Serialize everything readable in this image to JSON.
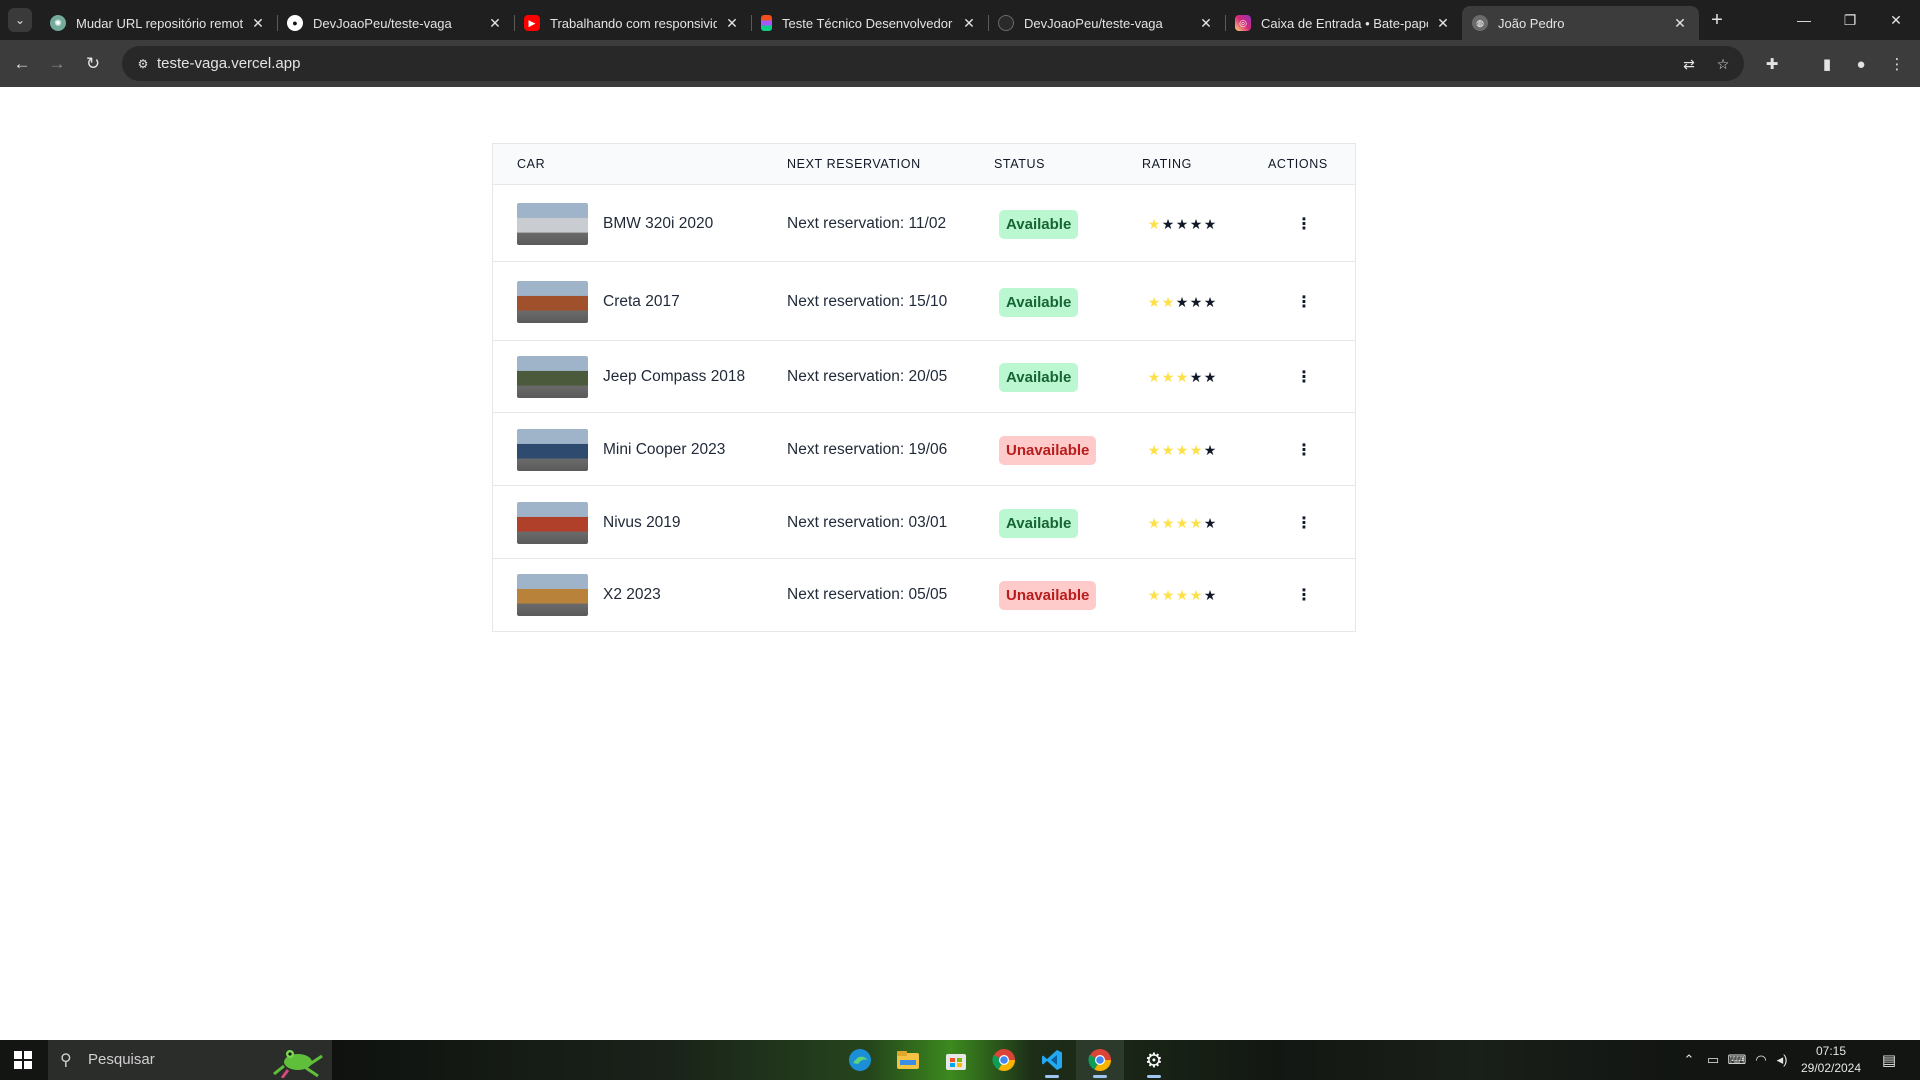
{
  "browser": {
    "tabs": [
      {
        "title": "Mudar URL repositório remoto.",
        "favicon": "chatgpt-icon",
        "active": false
      },
      {
        "title": "DevJoaoPeu/teste-vaga",
        "favicon": "github-icon",
        "active": false
      },
      {
        "title": "Trabalhando com responsividade",
        "favicon": "youtube-icon",
        "active": false
      },
      {
        "title": "Teste Técnico Desenvolvedor Jr",
        "favicon": "figma-icon",
        "active": false
      },
      {
        "title": "DevJoaoPeu/teste-vaga",
        "favicon": "github-icon",
        "active": false
      },
      {
        "title": "Caixa de Entrada • Bate-papos",
        "favicon": "instagram-icon",
        "active": false
      },
      {
        "title": "João Pedro",
        "favicon": "globe-icon",
        "active": true
      }
    ],
    "url": "teste-vaga.vercel.app"
  },
  "table": {
    "headers": {
      "car": "CAR",
      "next_reservation": "NEXT RESERVATION",
      "status": "STATUS",
      "rating": "RATING",
      "actions": "ACTIONS"
    },
    "rows": [
      {
        "name": "BMW 320i 2020",
        "reservation": "Next reservation: 11/02",
        "status": "Available",
        "rating": 1,
        "thumb_color": "#c9ccd0"
      },
      {
        "name": "Creta 2017",
        "reservation": "Next reservation: 15/10",
        "status": "Available",
        "rating": 2,
        "thumb_color": "#a0502a"
      },
      {
        "name": "Jeep Compass 2018",
        "reservation": "Next reservation: 20/05",
        "status": "Available",
        "rating": 3,
        "thumb_color": "#4a5a3a"
      },
      {
        "name": "Mini Cooper 2023",
        "reservation": "Next reservation: 19/06",
        "status": "Unavailable",
        "rating": 4,
        "thumb_color": "#2e4a6e"
      },
      {
        "name": "Nivus 2019",
        "reservation": "Next reservation: 03/01",
        "status": "Available",
        "rating": 4,
        "thumb_color": "#b0402a"
      },
      {
        "name": "X2 2023",
        "reservation": "Next reservation: 05/05",
        "status": "Unavailable",
        "rating": 4,
        "thumb_color": "#b8823a"
      }
    ],
    "max_rating": 5
  },
  "taskbar": {
    "search_placeholder": "Pesquisar",
    "time": "07:15",
    "date": "29/02/2024",
    "apps": [
      "edge-icon",
      "file-explorer-icon",
      "store-icon",
      "chrome-icon",
      "vscode-icon",
      "chrome-icon",
      "settings-icon"
    ]
  },
  "colors": {
    "available_bg": "#bbf7d0",
    "available_text": "#166534",
    "unavailable_bg": "#fecaca",
    "unavailable_text": "#b91c1c",
    "star_filled": "#fde047",
    "star_empty": "#111827"
  }
}
